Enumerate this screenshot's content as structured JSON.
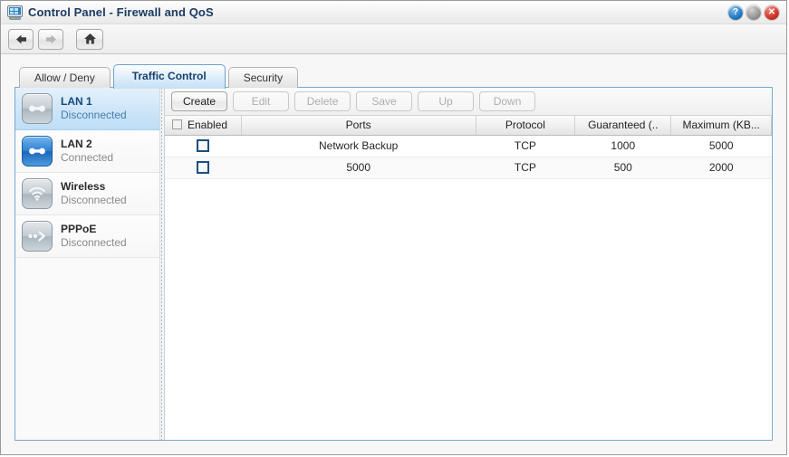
{
  "window": {
    "title": "Control Panel - Firewall and QoS",
    "icon": "control-panel-icon",
    "buttons": {
      "help": "?",
      "minimize": "",
      "close": "✕"
    }
  },
  "nav": {
    "back": "back-arrow-icon",
    "forward": "forward-arrow-icon",
    "home": "home-icon"
  },
  "tabs": [
    {
      "label": "Allow / Deny",
      "active": false
    },
    {
      "label": "Traffic Control",
      "active": true
    },
    {
      "label": "Security",
      "active": false
    }
  ],
  "sidebar": {
    "items": [
      {
        "name": "LAN 1",
        "status": "Disconnected",
        "icon": "lan-icon",
        "connected": false,
        "selected": true
      },
      {
        "name": "LAN 2",
        "status": "Connected",
        "icon": "lan-icon",
        "connected": true,
        "selected": false
      },
      {
        "name": "Wireless",
        "status": "Disconnected",
        "icon": "wifi-icon",
        "connected": false,
        "selected": false
      },
      {
        "name": "PPPoE",
        "status": "Disconnected",
        "icon": "pppoe-icon",
        "connected": false,
        "selected": false
      }
    ]
  },
  "toolbar": {
    "buttons": [
      {
        "label": "Create",
        "enabled": true
      },
      {
        "label": "Edit",
        "enabled": false
      },
      {
        "label": "Delete",
        "enabled": false
      },
      {
        "label": "Save",
        "enabled": false
      },
      {
        "label": "Up",
        "enabled": false
      },
      {
        "label": "Down",
        "enabled": false
      }
    ]
  },
  "table": {
    "columns": [
      {
        "key": "enabled",
        "label": "Enabled"
      },
      {
        "key": "ports",
        "label": "Ports"
      },
      {
        "key": "protocol",
        "label": "Protocol"
      },
      {
        "key": "guaranteed",
        "label": "Guaranteed (.."
      },
      {
        "key": "maximum",
        "label": "Maximum (KB..."
      }
    ],
    "rows": [
      {
        "enabled": false,
        "ports": "Network Backup",
        "protocol": "TCP",
        "guaranteed": "1000",
        "maximum": "5000"
      },
      {
        "enabled": false,
        "ports": "5000",
        "protocol": "TCP",
        "guaranteed": "500",
        "maximum": "2000"
      }
    ]
  },
  "colors": {
    "accent": "#78a9cd",
    "tab_active_text": "#17416e",
    "selected_row": "#cbe4f8",
    "connected_icon": "#2e7fd0"
  }
}
